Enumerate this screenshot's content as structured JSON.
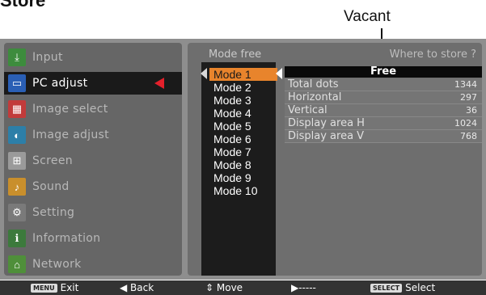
{
  "heading": "Store",
  "callout": "Vacant",
  "sidebar": {
    "items": [
      {
        "label": "Input",
        "icon": "input-icon"
      },
      {
        "label": "PC adjust",
        "icon": "pc-adjust-icon"
      },
      {
        "label": "Image select",
        "icon": "image-select-icon"
      },
      {
        "label": "Image adjust",
        "icon": "image-adjust-icon"
      },
      {
        "label": "Screen",
        "icon": "screen-icon"
      },
      {
        "label": "Sound",
        "icon": "sound-icon"
      },
      {
        "label": "Setting",
        "icon": "setting-icon"
      },
      {
        "label": "Information",
        "icon": "information-icon"
      },
      {
        "label": "Network",
        "icon": "network-icon"
      }
    ],
    "active_index": 1
  },
  "content": {
    "mode_title": "Mode free",
    "where_prompt": "Where to store ?",
    "modes": [
      "Mode 1",
      "Mode 2",
      "Mode 3",
      "Mode 4",
      "Mode 5",
      "Mode 6",
      "Mode 7",
      "Mode 8",
      "Mode 9",
      "Mode 10"
    ],
    "selected_mode": "Mode 1",
    "free_label": "Free",
    "info": [
      {
        "key": "Total dots",
        "value": "1344"
      },
      {
        "key": "Horizontal",
        "value": "297"
      },
      {
        "key": "Vertical",
        "value": "36"
      },
      {
        "key": "Display area H",
        "value": "1024"
      },
      {
        "key": "Display area V",
        "value": "768"
      }
    ]
  },
  "statusbar": {
    "exit_key": "MENU",
    "exit_label": "Exit",
    "back_label": "◀ Back",
    "move_label": "⇕ Move",
    "next_label": "▶-----",
    "select_key": "SELECT",
    "select_label": "Select"
  },
  "colors": {
    "accent": "#e4202b",
    "mode_highlight": "#e8842c"
  }
}
